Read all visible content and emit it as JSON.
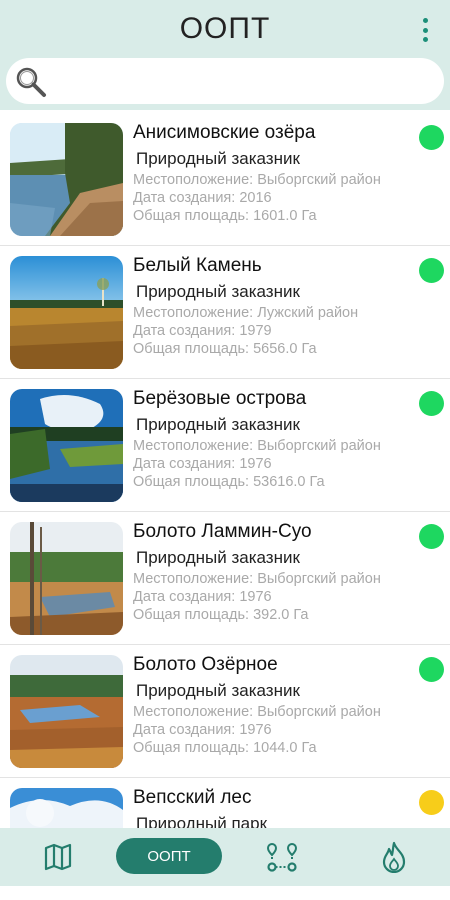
{
  "app": {
    "title": "ООПТ"
  },
  "search": {
    "placeholder": "",
    "value": ""
  },
  "items": [
    {
      "name": "Анисимовские озёра",
      "type": "Природный заказник",
      "location": "Местоположение: Выборгский район",
      "created": "Дата создания: 2016",
      "area": "Общая площадь: 1601.0 Га",
      "status_color": "#1ed760"
    },
    {
      "name": "Белый Камень",
      "type": "Природный заказник",
      "location": "Местоположение: Лужский район",
      "created": "Дата создания: 1979",
      "area": "Общая площадь: 5656.0 Га",
      "status_color": "#1ed760"
    },
    {
      "name": "Берёзовые острова",
      "type": "Природный заказник",
      "location": "Местоположение: Выборгский район",
      "created": "Дата создания: 1976",
      "area": "Общая площадь: 53616.0 Га",
      "status_color": "#1ed760"
    },
    {
      "name": "Болото Ламмин-Суо",
      "type": "Природный заказник",
      "location": "Местоположение: Выборгский район",
      "created": "Дата создания: 1976",
      "area": "Общая площадь: 392.0 Га",
      "status_color": "#1ed760"
    },
    {
      "name": "Болото Озёрное",
      "type": "Природный заказник",
      "location": "Местоположение: Выборгский район",
      "created": "Дата создания: 1976",
      "area": "Общая площадь: 1044.0 Га",
      "status_color": "#1ed760"
    },
    {
      "name": "Вепсский лес",
      "type": "Природный парк",
      "location": "",
      "created": "",
      "area": "",
      "status_color": "#f7cd1a"
    }
  ],
  "bottom_nav": {
    "oopt_label": "ООПТ",
    "icons": [
      "map-icon",
      "route-icon",
      "fire-icon"
    ]
  },
  "colors": {
    "bar_background": "#d9ece8",
    "accent": "#247d6d",
    "active_dot": "#1ed760",
    "warning_dot": "#f7cd1a"
  }
}
